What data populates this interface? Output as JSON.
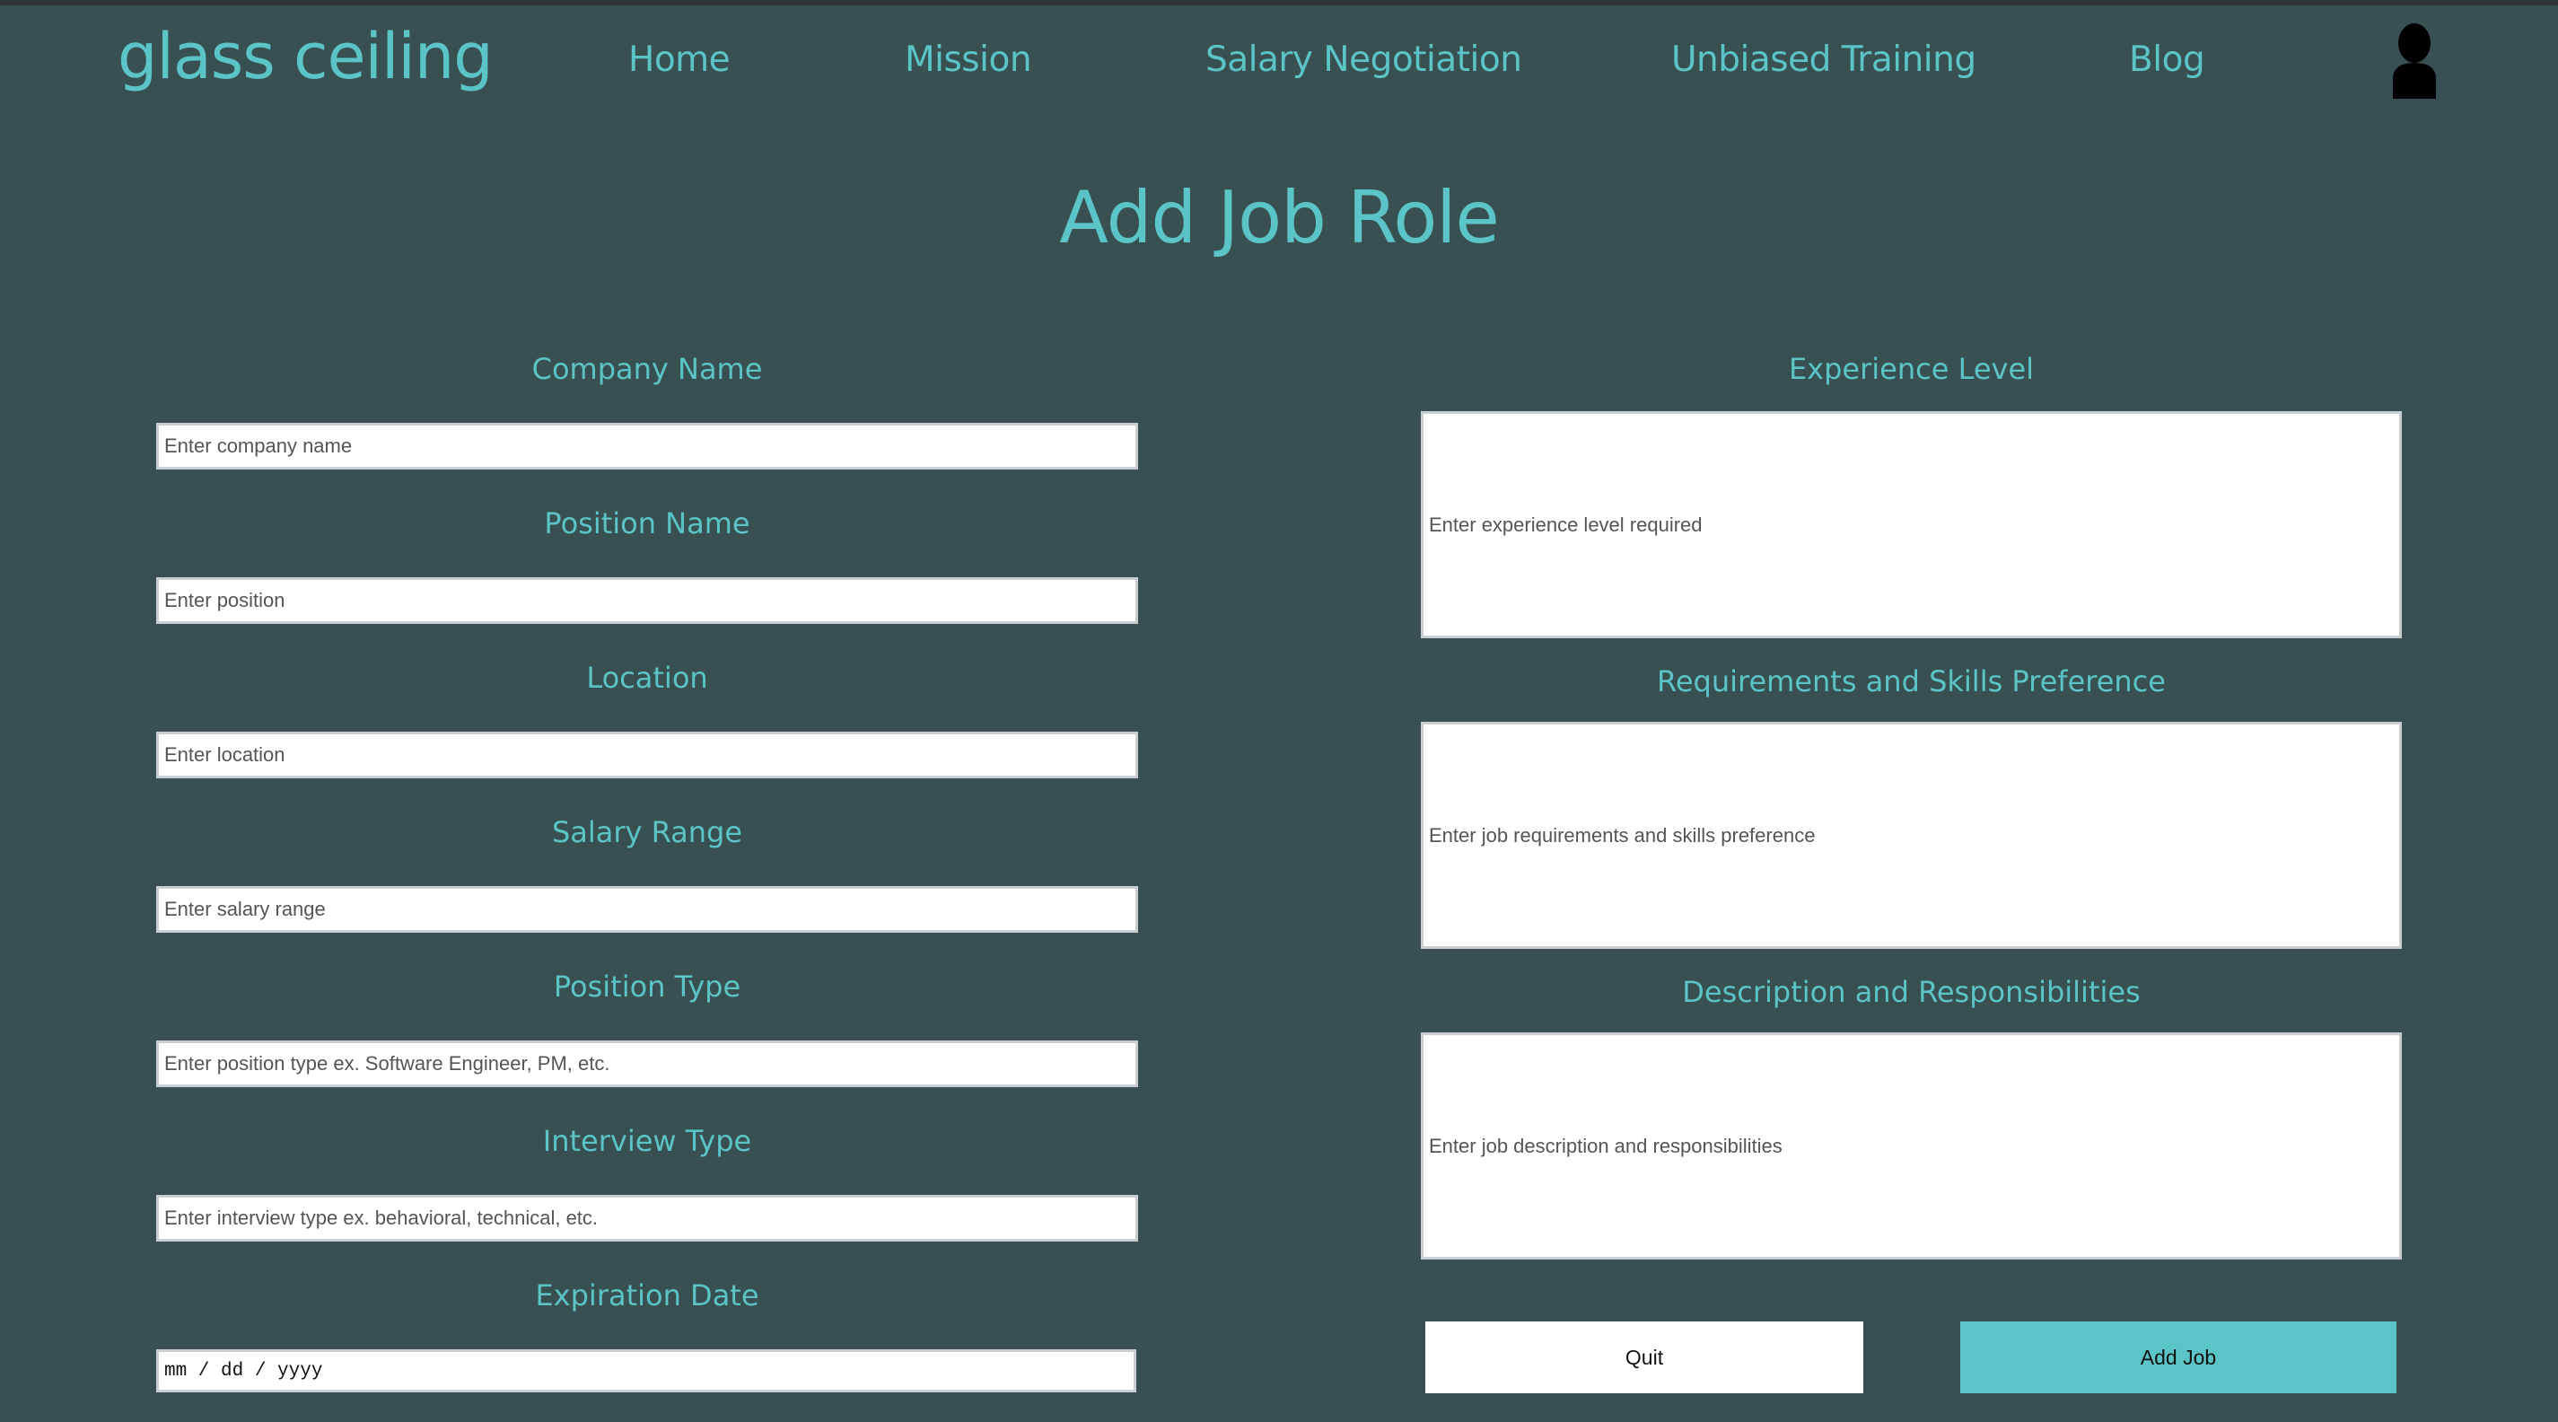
{
  "header": {
    "logo": "glass ceiling",
    "nav": [
      "Home",
      "Mission",
      "Salary Negotiation",
      "Unbiased Training",
      "Blog"
    ],
    "profile_icon": "user-silhouette-icon"
  },
  "page": {
    "title": "Add Job Role"
  },
  "form": {
    "company_name": {
      "label": "Company Name",
      "placeholder": "Enter company name"
    },
    "position_name": {
      "label": "Position Name",
      "placeholder": "Enter position"
    },
    "location": {
      "label": "Location",
      "placeholder": "Enter location"
    },
    "salary_range": {
      "label": "Salary Range",
      "placeholder": "Enter salary range"
    },
    "position_type": {
      "label": "Position Type",
      "placeholder": "Enter position type ex. Software Engineer, PM, etc."
    },
    "interview_type": {
      "label": "Interview Type",
      "placeholder": "Enter interview type ex. behavioral, technical, etc."
    },
    "expiration_date": {
      "label": "Expiration Date",
      "placeholder": "mm / dd / yyyy"
    },
    "experience_level": {
      "label": "Experience Level",
      "placeholder": "Enter experience level required"
    },
    "requirements": {
      "label": "Requirements and Skills Preference",
      "placeholder": "Enter job requirements and skills preference"
    },
    "description": {
      "label": "Description and Responsibilities",
      "placeholder": "Enter job description and responsibilities"
    }
  },
  "buttons": {
    "quit": "Quit",
    "add": "Add Job"
  },
  "colors": {
    "background": "#385052",
    "accent": "#5bc4c6",
    "input_bg": "#ffffff"
  }
}
